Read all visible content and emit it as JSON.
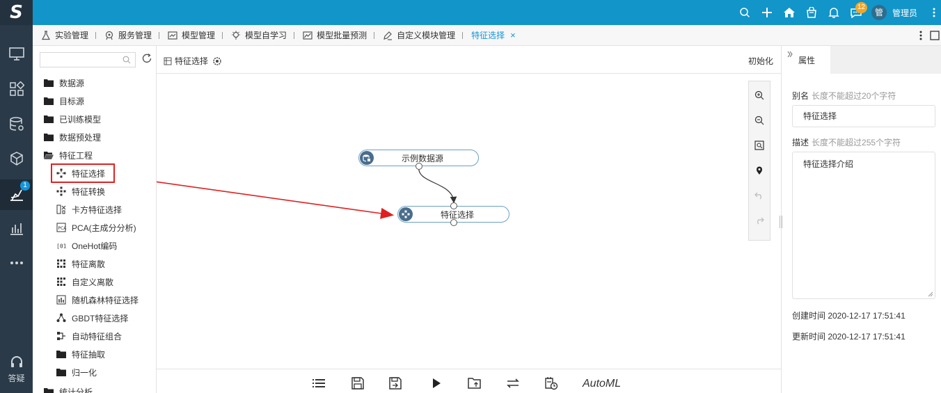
{
  "app": {
    "logo_text": "S",
    "nav_badge": "1",
    "help_label": "答疑"
  },
  "header": {
    "message_badge": "12",
    "avatar_text": "管",
    "username": "管理员"
  },
  "tabs": [
    {
      "label": "实验管理",
      "icon": "flask-icon"
    },
    {
      "label": "服务管理",
      "icon": "service-icon"
    },
    {
      "label": "模型管理",
      "icon": "model-icon"
    },
    {
      "label": "模型自学习",
      "icon": "bulb-icon"
    },
    {
      "label": "模型批量预测",
      "icon": "chart-line-icon"
    },
    {
      "label": "自定义模块管理",
      "icon": "edit-doc-icon"
    },
    {
      "label": "特征选择",
      "icon": "",
      "active": true
    }
  ],
  "tab_close": "×",
  "tree": {
    "search_placeholder": "",
    "items": [
      {
        "label": "数据源",
        "type": "folder"
      },
      {
        "label": "目标源",
        "type": "folder"
      },
      {
        "label": "已训练模型",
        "type": "folder"
      },
      {
        "label": "数据预处理",
        "type": "folder"
      },
      {
        "label": "特征工程",
        "type": "folder-open"
      },
      {
        "label": "特征选择",
        "type": "leaf"
      },
      {
        "label": "特征转换",
        "type": "leaf"
      },
      {
        "label": "卡方特征选择",
        "type": "leaf"
      },
      {
        "label": "PCA(主成分分析)",
        "type": "leaf"
      },
      {
        "label": "OneHot编码",
        "type": "leaf"
      },
      {
        "label": "特征离散",
        "type": "leaf"
      },
      {
        "label": "自定义离散",
        "type": "leaf"
      },
      {
        "label": "随机森林特征选择",
        "type": "leaf"
      },
      {
        "label": "GBDT特征选择",
        "type": "leaf"
      },
      {
        "label": "自动特征组合",
        "type": "leaf"
      },
      {
        "label": "特征抽取",
        "type": "subfolder"
      },
      {
        "label": "归一化",
        "type": "subfolder"
      },
      {
        "label": "统计分析",
        "type": "folder"
      }
    ]
  },
  "canvas": {
    "title": "特征选择",
    "init_label": "初始化",
    "nodes": [
      {
        "label": "示例数据源"
      },
      {
        "label": "特征选择"
      }
    ],
    "toolbar_automl": "AutoML"
  },
  "props": {
    "tab_label": "属性",
    "alias_label": "别名",
    "alias_hint": "长度不能超过20个字符",
    "alias_value": "特征选择",
    "desc_label": "描述",
    "desc_hint": "长度不能超过255个字符",
    "desc_value": "特征选择介绍",
    "created": "创建时间 2020-12-17 17:51:41",
    "updated": "更新时间 2020-12-17 17:51:41"
  },
  "colors": {
    "header_bg": "#1295c9",
    "nav_bg": "#2b3a48",
    "accent": "#1296db",
    "annotation": "#e02020"
  }
}
